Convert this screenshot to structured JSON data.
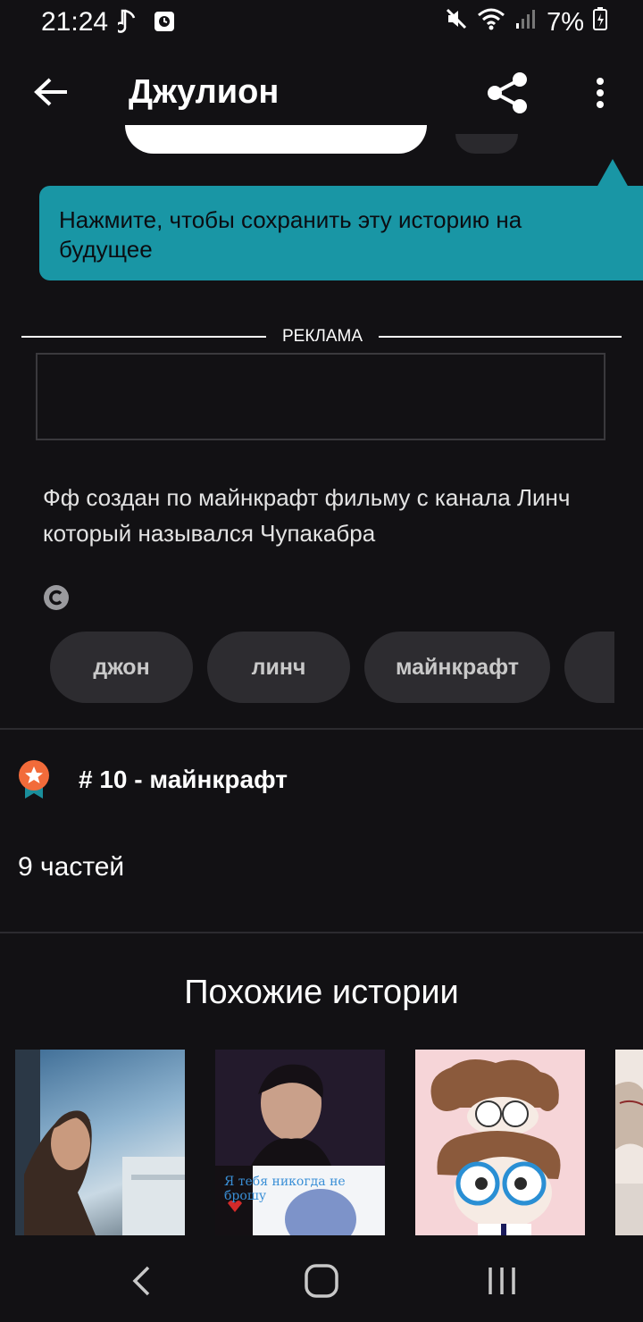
{
  "status_bar": {
    "time": "21:24",
    "battery": "7%"
  },
  "app_bar": {
    "title": "Джулион"
  },
  "tooltip": {
    "text": "Нажмите, чтобы сохранить эту историю на будущее"
  },
  "ad": {
    "label": "РЕКЛАМА"
  },
  "description": "Фф создан по майнкрафт фильму с канала Линч который назывался Чупакабра",
  "tags": [
    "джон",
    "линч",
    "майнкрафт",
    ""
  ],
  "ranking": {
    "text": "# 10 - майнкрафт"
  },
  "parts": "9 частей",
  "similar": {
    "title": "Похожие истории",
    "covers": [
      {
        "overlay_text": ""
      },
      {
        "overlay_text": "Я тебя никогда не брошу"
      },
      {
        "overlay_text": ""
      },
      {
        "overlay_text": ""
      }
    ]
  },
  "colors": {
    "background": "#121114",
    "tooltip": "#1996a5",
    "tag_bg": "#2d2c30",
    "rank_badge": "#f26b3a"
  }
}
